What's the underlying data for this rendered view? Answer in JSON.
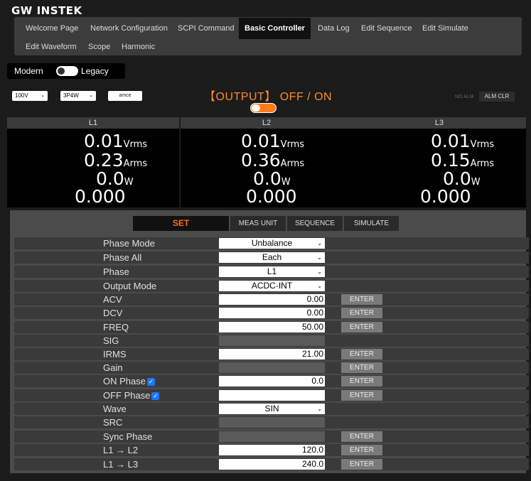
{
  "brand": {
    "logo": "GW INSTEK"
  },
  "nav": {
    "items": [
      {
        "label": "Welcome Page"
      },
      {
        "label": "Network Configuration"
      },
      {
        "label": "SCPI Command"
      },
      {
        "label": "Basic Controller"
      },
      {
        "label": "Data Log"
      },
      {
        "label": "Edit Sequence"
      },
      {
        "label": "Edit Simulate"
      },
      {
        "label": "Edit Waveform"
      },
      {
        "label": "Scope"
      },
      {
        "label": "Harmonic"
      }
    ]
  },
  "mode": {
    "left": "Modern",
    "right": "Legacy"
  },
  "controls": {
    "range": "100V",
    "wiring": "3P4W",
    "button": "amce"
  },
  "output": {
    "bracket_label": "【OUTPUT】",
    "state_text": "OFF / ON"
  },
  "alarm": {
    "status": "NO ALM",
    "clear": "ALM CLR"
  },
  "meters": [
    {
      "name": "L1",
      "vrms": "0.01",
      "arms": "0.23",
      "w": "0.0",
      "pf": "0.000"
    },
    {
      "name": "L2",
      "vrms": "0.01",
      "arms": "0.36",
      "w": "0.0",
      "pf": "0.000"
    },
    {
      "name": "L3",
      "vrms": "0.01",
      "arms": "0.15",
      "w": "0.0",
      "pf": "0.000"
    }
  ],
  "units": {
    "vrms": "Vrms",
    "arms": "Arms",
    "w": "W"
  },
  "tabs": [
    {
      "label": "SET"
    },
    {
      "label": "MEAS UNIT"
    },
    {
      "label": "SEQUENCE"
    },
    {
      "label": "SIMULATE"
    }
  ],
  "settings": {
    "enter_label": "ENTER",
    "rows": [
      {
        "label": "Phase Mode",
        "value": "Unbalance"
      },
      {
        "label": "Phase All",
        "value": "Each"
      },
      {
        "label": "Phase",
        "value": "L1"
      },
      {
        "label": "Output Mode",
        "value": "ACDC-INT"
      },
      {
        "label": "ACV",
        "value": "0.00"
      },
      {
        "label": "DCV",
        "value": "0.00"
      },
      {
        "label": "FREQ",
        "value": "50.00"
      },
      {
        "label": "SIG",
        "value": ""
      },
      {
        "label": "IRMS",
        "value": "21.00"
      },
      {
        "label": "Gain",
        "value": ""
      },
      {
        "label": "ON Phase",
        "value": "0.0"
      },
      {
        "label": "OFF Phase",
        "value": ""
      },
      {
        "label": "Wave",
        "value": "SIN"
      },
      {
        "label": "SRC",
        "value": ""
      },
      {
        "label": "Sync Phase",
        "value": ""
      },
      {
        "label": "L1 → L2",
        "value": "120.0"
      },
      {
        "label": "L1 → L3",
        "value": "240.0"
      }
    ]
  }
}
